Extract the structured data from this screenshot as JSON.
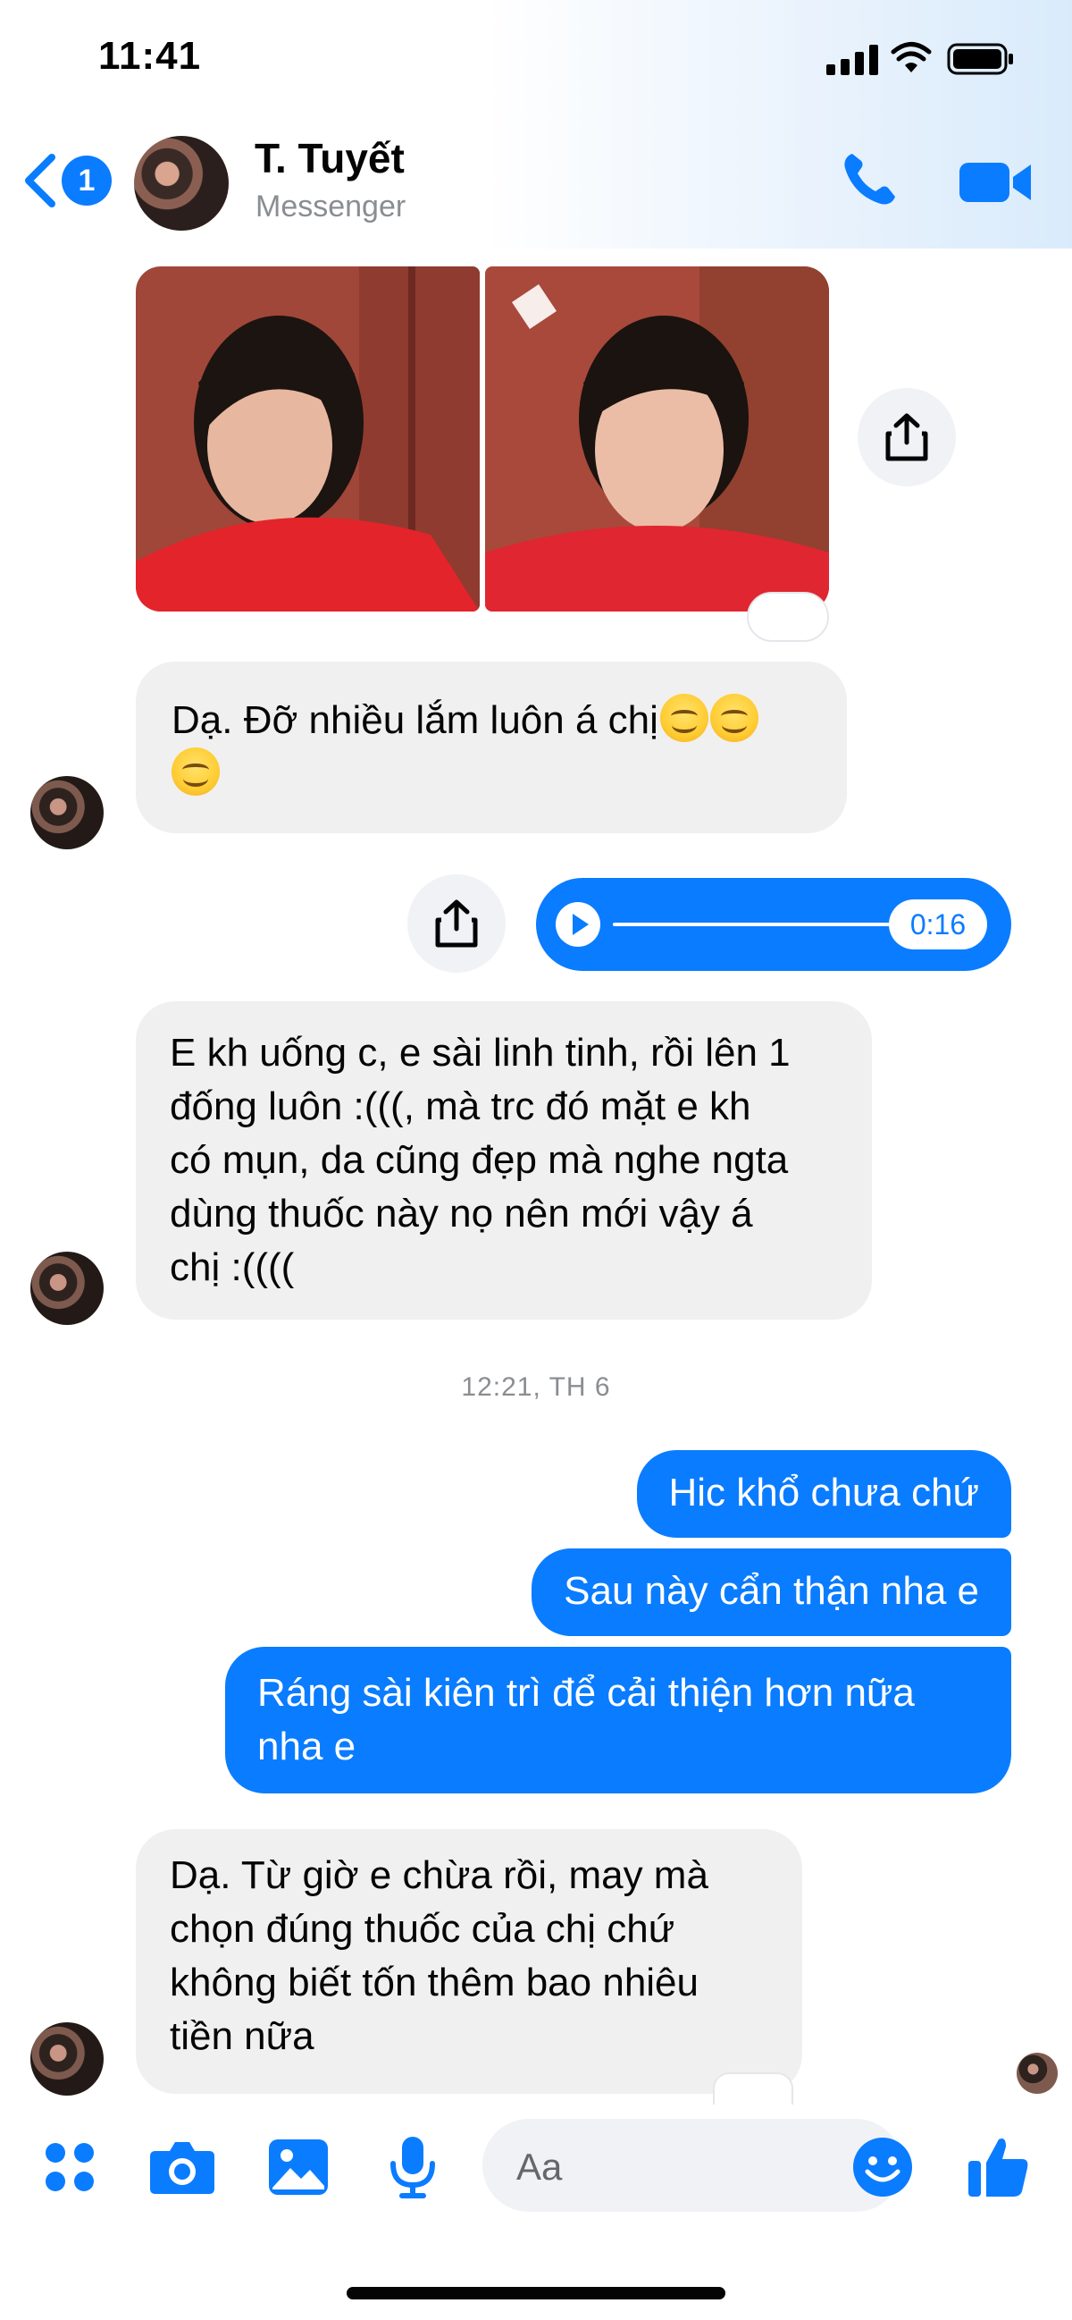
{
  "status_bar": {
    "time": "11:41"
  },
  "header": {
    "back_badge": "1",
    "contact_name": "T. Tuyết",
    "contact_subtitle": "Messenger",
    "icons": [
      "chevron-left-icon",
      "phone-icon",
      "video-camera-icon"
    ],
    "accent_color": "#0a7cff"
  },
  "messages": {
    "m1": {
      "text": "Dạ. Đỡ nhiều lắm luôn á chị",
      "emoji_count": 3
    },
    "voice": {
      "duration": "0:16"
    },
    "m2": {
      "lines": [
        "E kh uống c, e sài linh tinh, rồi lên 1",
        "đống luôn :(((, mà trc đó mặt e kh",
        "có mụn, da cũng đẹp mà nghe ngta",
        "dùng thuốc này nọ nên mới vậy á",
        "chị :(((("
      ]
    },
    "timestamp": "12:21, TH 6",
    "out1": "Hic khổ chưa chứ",
    "out2": "Sau này cẩn thận nha e",
    "out3": {
      "lines": [
        "Ráng sài kiên trì để cải thiện hơn nữa",
        "nha e"
      ]
    },
    "m3": {
      "lines": [
        "Dạ. Từ giờ e chừa rồi, may mà",
        "chọn đúng thuốc của chị chứ",
        "không biết tốn thêm bao nhiêu",
        "tiền nữa"
      ]
    }
  },
  "composer": {
    "placeholder": "Aa",
    "icons": [
      "apps-grid-icon",
      "camera-icon",
      "gallery-icon",
      "microphone-icon",
      "emoji-icon",
      "thumbs-up-icon"
    ]
  }
}
